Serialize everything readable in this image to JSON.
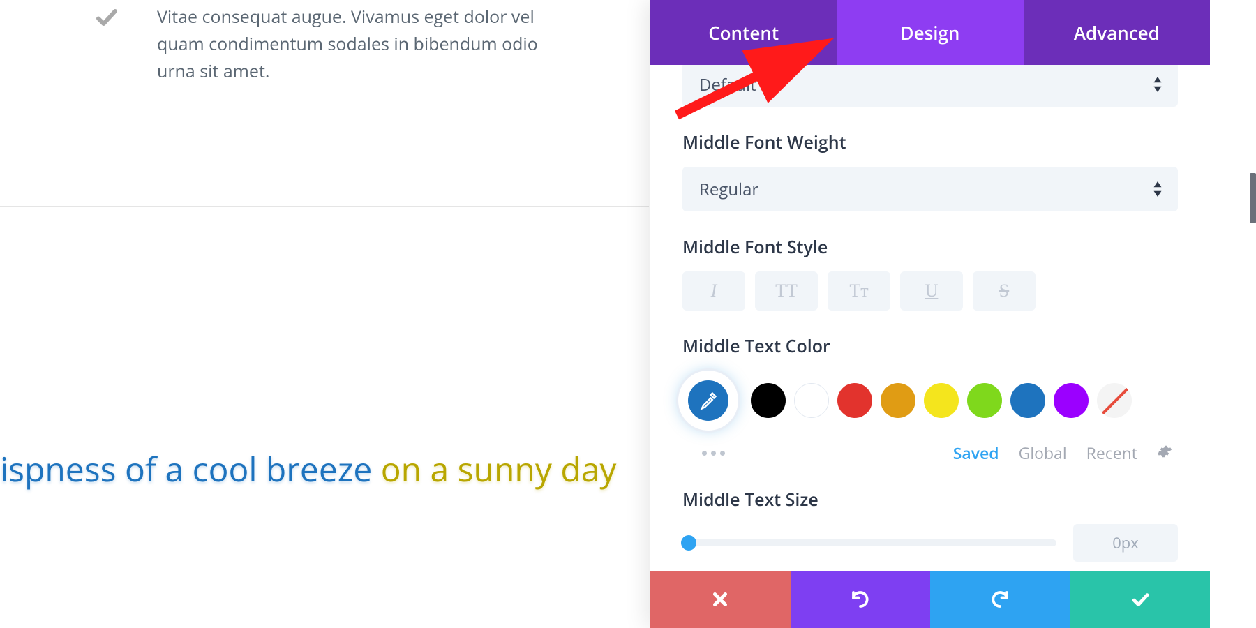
{
  "left": {
    "listText": "Vitae consequat augue. Vivamus eget dolor vel quam condimentum sodales in bibendum odio urna sit amet.",
    "previewBlue": "ispness of a cool breeze",
    "previewYellow": " on a sunny day"
  },
  "tabs": {
    "content": "Content",
    "design": "Design",
    "advanced": "Advanced"
  },
  "design": {
    "topDropdownValue": "Default",
    "fontWeight": {
      "label": "Middle Font Weight",
      "value": "Regular"
    },
    "fontStyle": {
      "label": "Middle Font Style",
      "italic": "I",
      "uppercase": "TT",
      "smallcaps": "Tᴛ",
      "underline": "U",
      "strike": "S"
    },
    "textColor": {
      "label": "Middle Text Color",
      "swatches": [
        "#000000",
        "#ffffff",
        "#e2332d",
        "#e09c14",
        "#f4e51d",
        "#7fd81c",
        "#1e73be",
        "#9b00ff"
      ],
      "tabs": {
        "saved": "Saved",
        "global": "Global",
        "recent": "Recent"
      }
    },
    "textSize": {
      "label": "Middle Text Size",
      "value": "0px"
    }
  }
}
